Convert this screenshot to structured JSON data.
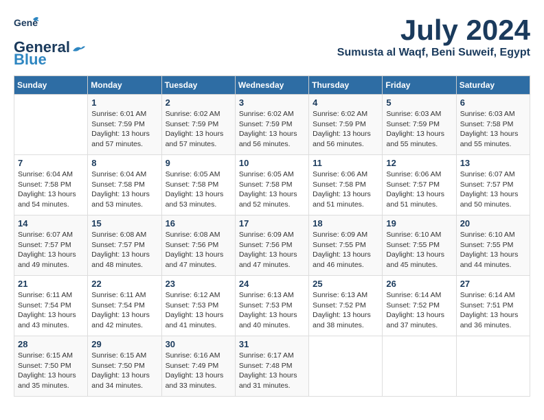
{
  "logo": {
    "line1": "General",
    "line2": "Blue"
  },
  "header": {
    "month": "July 2024",
    "location": "Sumusta al Waqf, Beni Suweif, Egypt"
  },
  "weekdays": [
    "Sunday",
    "Monday",
    "Tuesday",
    "Wednesday",
    "Thursday",
    "Friday",
    "Saturday"
  ],
  "weeks": [
    [
      {
        "day": "",
        "sunrise": "",
        "sunset": "",
        "daylight": ""
      },
      {
        "day": "1",
        "sunrise": "6:01 AM",
        "sunset": "7:59 PM",
        "daylight": "13 hours and 57 minutes."
      },
      {
        "day": "2",
        "sunrise": "6:02 AM",
        "sunset": "7:59 PM",
        "daylight": "13 hours and 57 minutes."
      },
      {
        "day": "3",
        "sunrise": "6:02 AM",
        "sunset": "7:59 PM",
        "daylight": "13 hours and 56 minutes."
      },
      {
        "day": "4",
        "sunrise": "6:02 AM",
        "sunset": "7:59 PM",
        "daylight": "13 hours and 56 minutes."
      },
      {
        "day": "5",
        "sunrise": "6:03 AM",
        "sunset": "7:59 PM",
        "daylight": "13 hours and 55 minutes."
      },
      {
        "day": "6",
        "sunrise": "6:03 AM",
        "sunset": "7:58 PM",
        "daylight": "13 hours and 55 minutes."
      }
    ],
    [
      {
        "day": "7",
        "sunrise": "6:04 AM",
        "sunset": "7:58 PM",
        "daylight": "13 hours and 54 minutes."
      },
      {
        "day": "8",
        "sunrise": "6:04 AM",
        "sunset": "7:58 PM",
        "daylight": "13 hours and 53 minutes."
      },
      {
        "day": "9",
        "sunrise": "6:05 AM",
        "sunset": "7:58 PM",
        "daylight": "13 hours and 53 minutes."
      },
      {
        "day": "10",
        "sunrise": "6:05 AM",
        "sunset": "7:58 PM",
        "daylight": "13 hours and 52 minutes."
      },
      {
        "day": "11",
        "sunrise": "6:06 AM",
        "sunset": "7:58 PM",
        "daylight": "13 hours and 51 minutes."
      },
      {
        "day": "12",
        "sunrise": "6:06 AM",
        "sunset": "7:57 PM",
        "daylight": "13 hours and 51 minutes."
      },
      {
        "day": "13",
        "sunrise": "6:07 AM",
        "sunset": "7:57 PM",
        "daylight": "13 hours and 50 minutes."
      }
    ],
    [
      {
        "day": "14",
        "sunrise": "6:07 AM",
        "sunset": "7:57 PM",
        "daylight": "13 hours and 49 minutes."
      },
      {
        "day": "15",
        "sunrise": "6:08 AM",
        "sunset": "7:57 PM",
        "daylight": "13 hours and 48 minutes."
      },
      {
        "day": "16",
        "sunrise": "6:08 AM",
        "sunset": "7:56 PM",
        "daylight": "13 hours and 47 minutes."
      },
      {
        "day": "17",
        "sunrise": "6:09 AM",
        "sunset": "7:56 PM",
        "daylight": "13 hours and 47 minutes."
      },
      {
        "day": "18",
        "sunrise": "6:09 AM",
        "sunset": "7:55 PM",
        "daylight": "13 hours and 46 minutes."
      },
      {
        "day": "19",
        "sunrise": "6:10 AM",
        "sunset": "7:55 PM",
        "daylight": "13 hours and 45 minutes."
      },
      {
        "day": "20",
        "sunrise": "6:10 AM",
        "sunset": "7:55 PM",
        "daylight": "13 hours and 44 minutes."
      }
    ],
    [
      {
        "day": "21",
        "sunrise": "6:11 AM",
        "sunset": "7:54 PM",
        "daylight": "13 hours and 43 minutes."
      },
      {
        "day": "22",
        "sunrise": "6:11 AM",
        "sunset": "7:54 PM",
        "daylight": "13 hours and 42 minutes."
      },
      {
        "day": "23",
        "sunrise": "6:12 AM",
        "sunset": "7:53 PM",
        "daylight": "13 hours and 41 minutes."
      },
      {
        "day": "24",
        "sunrise": "6:13 AM",
        "sunset": "7:53 PM",
        "daylight": "13 hours and 40 minutes."
      },
      {
        "day": "25",
        "sunrise": "6:13 AM",
        "sunset": "7:52 PM",
        "daylight": "13 hours and 38 minutes."
      },
      {
        "day": "26",
        "sunrise": "6:14 AM",
        "sunset": "7:52 PM",
        "daylight": "13 hours and 37 minutes."
      },
      {
        "day": "27",
        "sunrise": "6:14 AM",
        "sunset": "7:51 PM",
        "daylight": "13 hours and 36 minutes."
      }
    ],
    [
      {
        "day": "28",
        "sunrise": "6:15 AM",
        "sunset": "7:50 PM",
        "daylight": "13 hours and 35 minutes."
      },
      {
        "day": "29",
        "sunrise": "6:15 AM",
        "sunset": "7:50 PM",
        "daylight": "13 hours and 34 minutes."
      },
      {
        "day": "30",
        "sunrise": "6:16 AM",
        "sunset": "7:49 PM",
        "daylight": "13 hours and 33 minutes."
      },
      {
        "day": "31",
        "sunrise": "6:17 AM",
        "sunset": "7:48 PM",
        "daylight": "13 hours and 31 minutes."
      },
      {
        "day": "",
        "sunrise": "",
        "sunset": "",
        "daylight": ""
      },
      {
        "day": "",
        "sunrise": "",
        "sunset": "",
        "daylight": ""
      },
      {
        "day": "",
        "sunrise": "",
        "sunset": "",
        "daylight": ""
      }
    ]
  ]
}
